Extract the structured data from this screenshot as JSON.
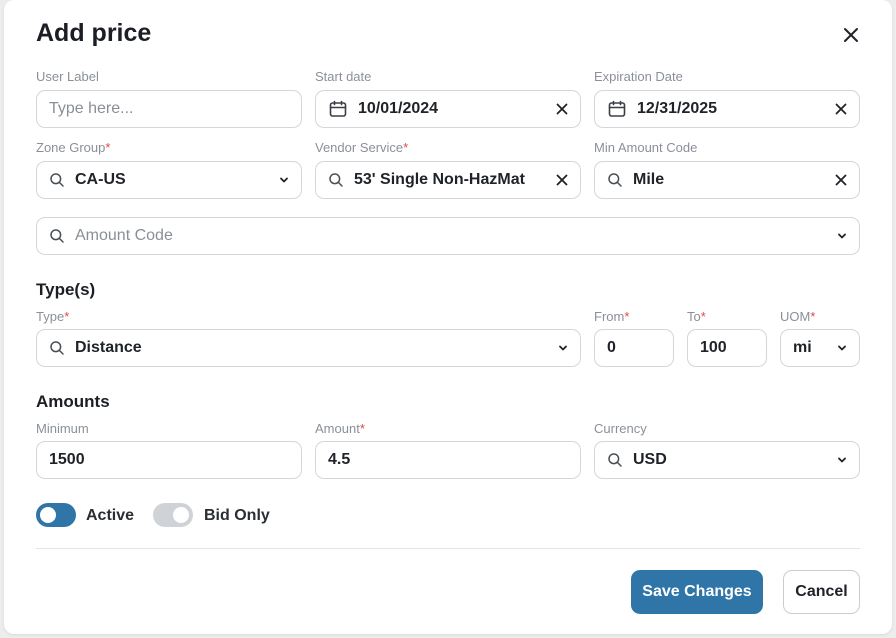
{
  "dialog": {
    "title": "Add price"
  },
  "fields": {
    "user_label": {
      "label": "User Label",
      "placeholder": "Type here..."
    },
    "start_date": {
      "label": "Start date",
      "value": "10/01/2024"
    },
    "expiration_date": {
      "label": "Expiration Date",
      "value": "12/31/2025"
    },
    "zone_group": {
      "label": "Zone Group",
      "value": "CA-US",
      "required": true
    },
    "vendor_service": {
      "label": "Vendor Service",
      "value": "53' Single Non-HazMat",
      "required": true
    },
    "min_amount_code": {
      "label": "Min Amount Code",
      "value": "Mile"
    },
    "amount_code": {
      "placeholder": "Amount Code"
    }
  },
  "types_section": {
    "title": "Type(s)",
    "type": {
      "label": "Type",
      "value": "Distance",
      "required": true
    },
    "from": {
      "label": "From",
      "value": "0",
      "required": true
    },
    "to": {
      "label": "To",
      "value": "100",
      "required": true
    },
    "uom": {
      "label": "UOM",
      "value": "mi",
      "required": true
    }
  },
  "amounts_section": {
    "title": "Amounts",
    "minimum": {
      "label": "Minimum",
      "value": "1500"
    },
    "amount": {
      "label": "Amount",
      "value": "4.5",
      "required": true
    },
    "currency": {
      "label": "Currency",
      "value": "USD"
    }
  },
  "toggles": {
    "active": {
      "label": "Active",
      "on": true
    },
    "bid_only": {
      "label": "Bid Only",
      "on": false
    }
  },
  "footer": {
    "save_label": "Save Changes",
    "cancel_label": "Cancel"
  },
  "colors": {
    "accent": "#2f75a8",
    "required_marker": "#e04848",
    "toggle_off": "#cfd2d6"
  },
  "icons": {
    "close": "close-icon",
    "calendar": "calendar-icon",
    "search": "search-icon",
    "chevron": "chevron-down-icon",
    "clear": "clear-icon"
  }
}
